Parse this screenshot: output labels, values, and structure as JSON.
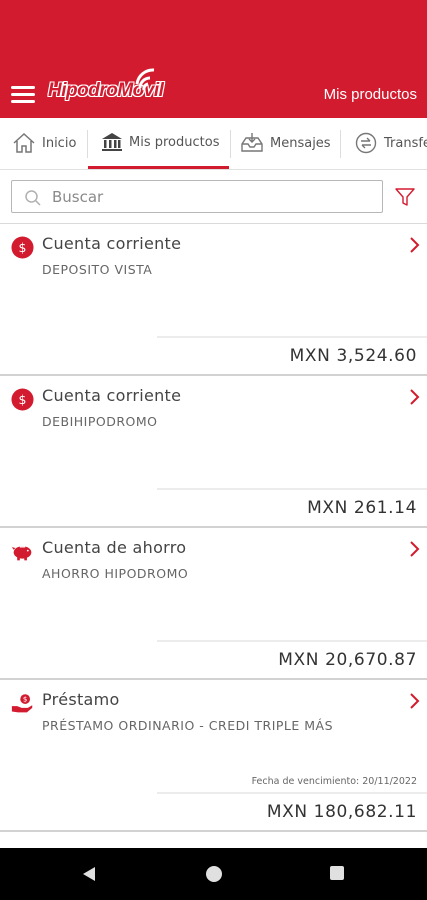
{
  "header": {
    "logo_part1": "Hipodro",
    "logo_part2": "Movil",
    "title": "Mis productos",
    "colors": {
      "brand": "#d31b2f"
    }
  },
  "tabs": [
    {
      "label": "Inicio",
      "icon": "home-icon"
    },
    {
      "label": "Mis productos",
      "icon": "bank-icon",
      "active": true
    },
    {
      "label": "Mensajes",
      "icon": "inbox-icon"
    },
    {
      "label": "Transfe",
      "icon": "transfer-icon"
    }
  ],
  "search": {
    "placeholder": "Buscar",
    "value": ""
  },
  "products": [
    {
      "icon": "dollar-coin-icon",
      "title": "Cuenta corriente",
      "subtitle": "DEPOSITO VISTA",
      "amount": "MXN 3,524.60"
    },
    {
      "icon": "dollar-coin-icon",
      "title": "Cuenta corriente",
      "subtitle": "DEBIHIPODROMO",
      "amount": "MXN 261.14"
    },
    {
      "icon": "piggy-bank-icon",
      "title": "Cuenta de ahorro",
      "subtitle": "AHORRO HIPODROMO",
      "amount": "MXN 20,670.87"
    },
    {
      "icon": "loan-hand-icon",
      "title": "Préstamo",
      "subtitle": "PRÉSTAMO ORDINARIO - CREDI TRIPLE MÁS",
      "note": "Fecha de vencimiento: 20/11/2022",
      "amount": "MXN 180,682.11"
    }
  ],
  "navbar": {
    "buttons": [
      "back-icon",
      "home-circle-icon",
      "recents-square-icon"
    ]
  }
}
